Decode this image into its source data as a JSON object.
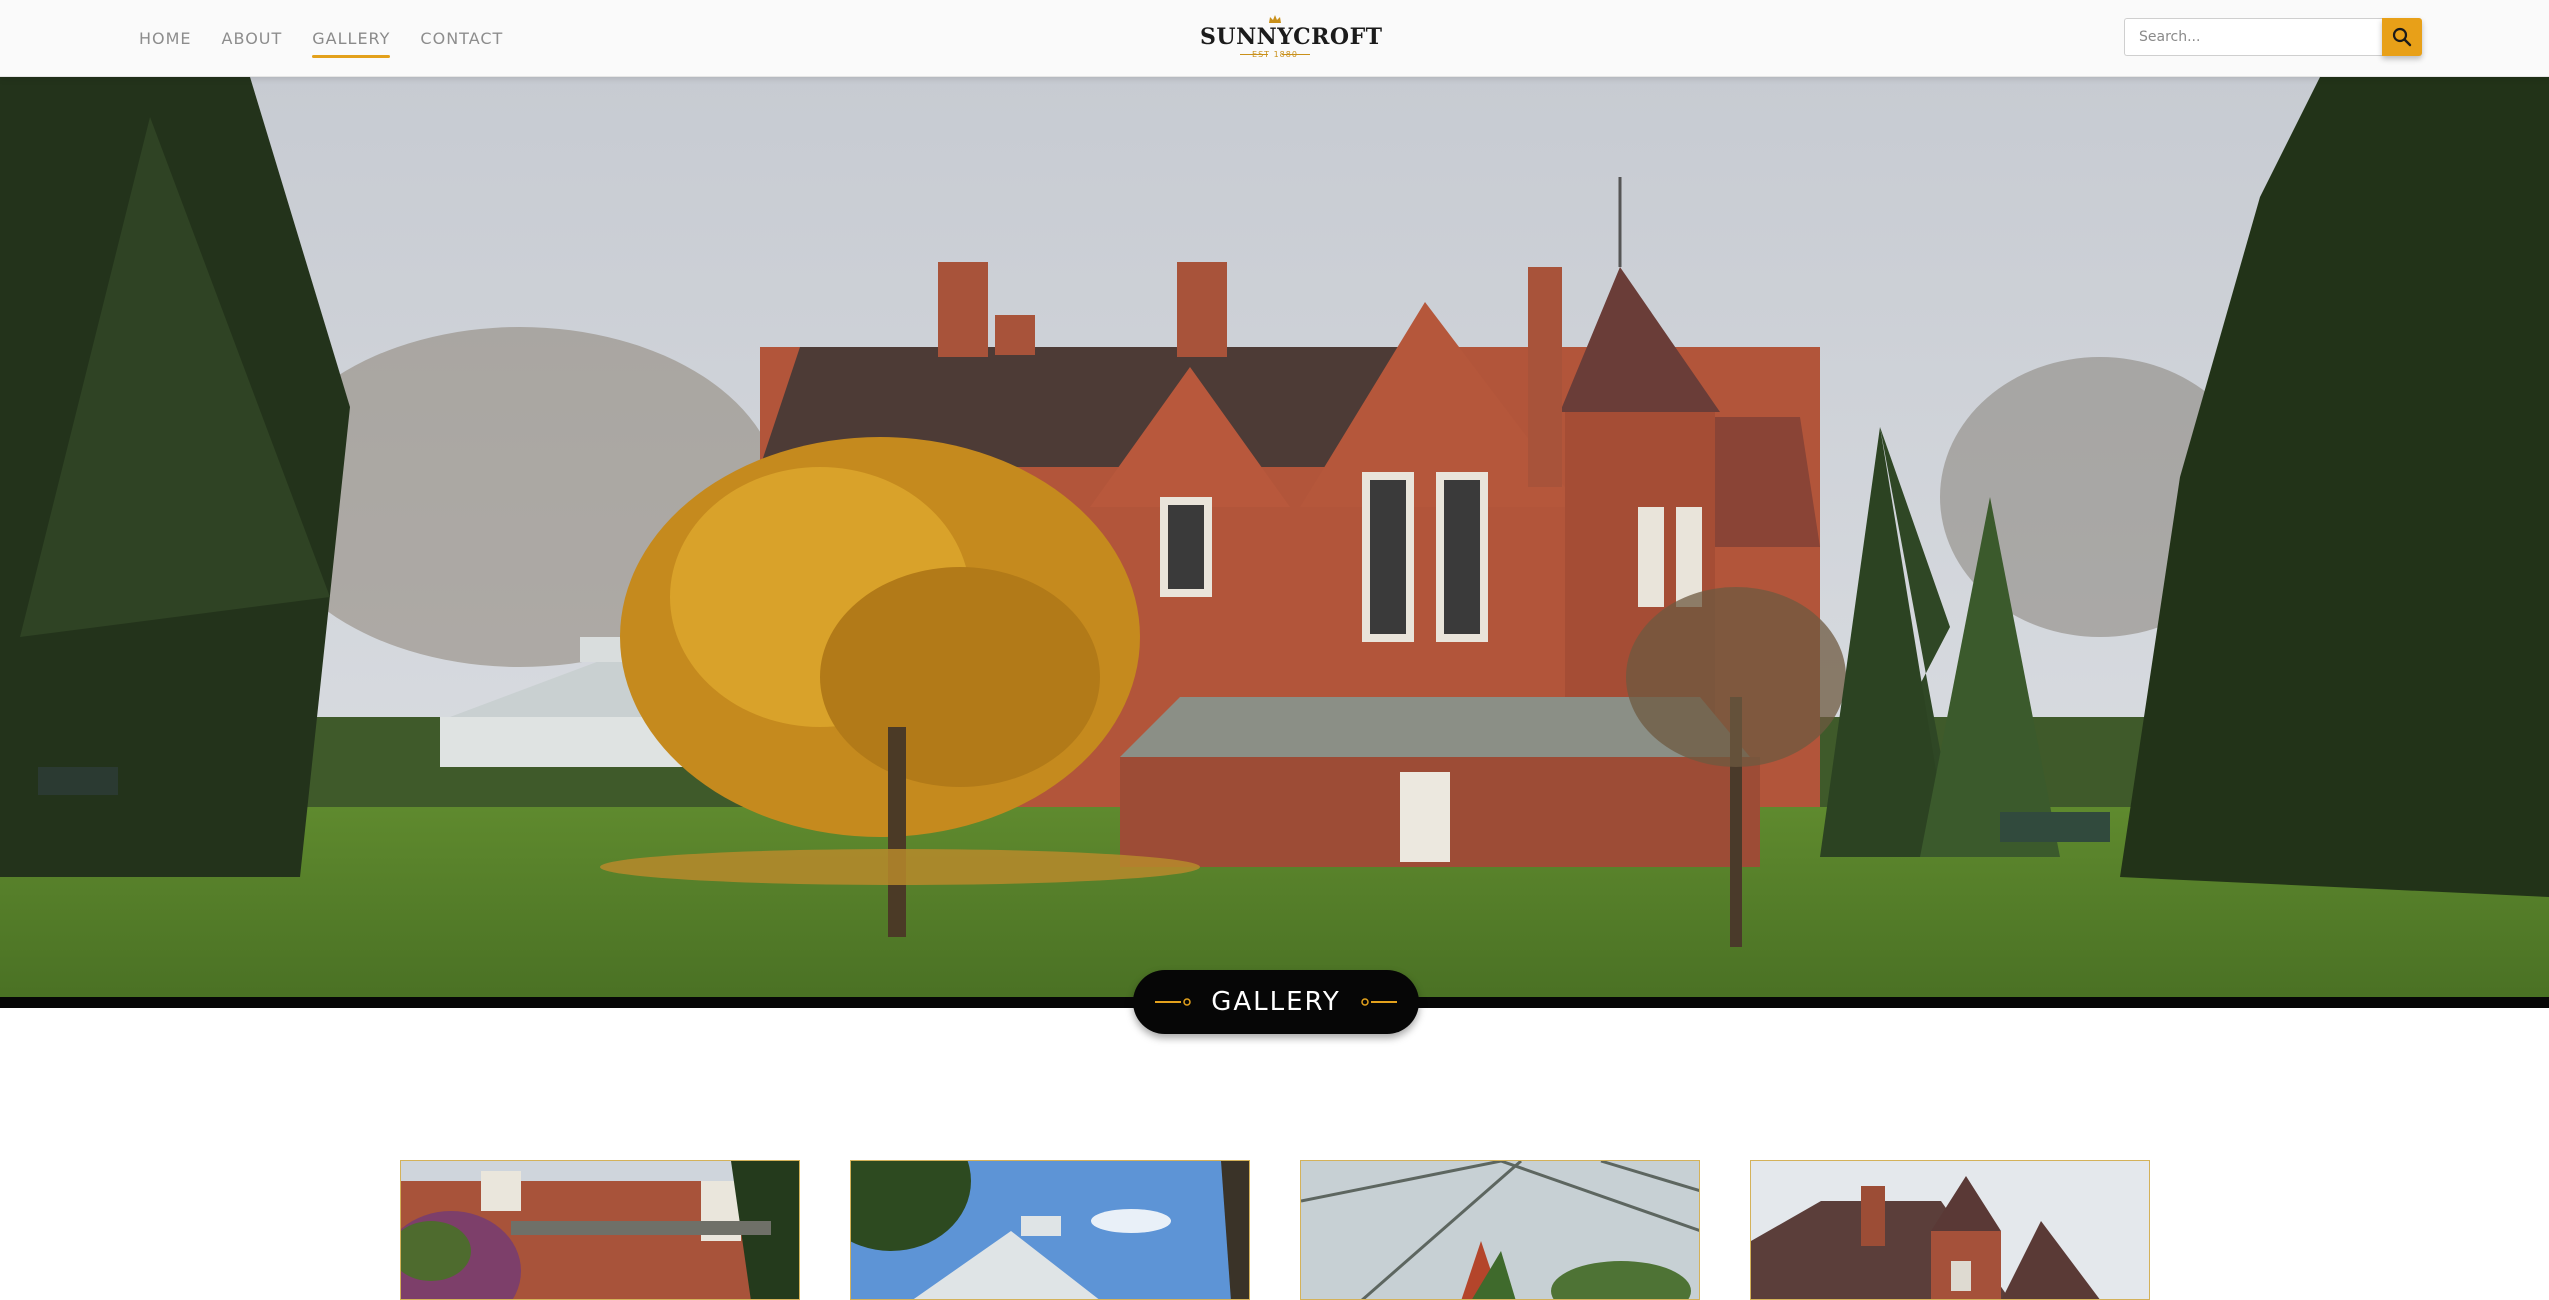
{
  "header": {
    "nav": [
      {
        "label": "HOME",
        "active": false
      },
      {
        "label": "ABOUT",
        "active": false
      },
      {
        "label": "GALLERY",
        "active": true
      },
      {
        "label": "CONTACT",
        "active": false
      }
    ],
    "logo": {
      "name": "SUNNYCROFT",
      "est": "EST 1880",
      "icon": "crown-icon"
    },
    "search": {
      "placeholder": "Search...",
      "value": "",
      "button_icon": "search-icon"
    }
  },
  "hero": {
    "image": "victorian-red-brick-house-with-conservatory-and-autumn-tree",
    "badge_label": "GALLERY"
  },
  "gallery": {
    "thumbnails": [
      {
        "image": "brick-house-with-flowering-shrubs"
      },
      {
        "image": "glass-conservatory-blue-sky"
      },
      {
        "image": "conservatory-interior-glass-roof"
      },
      {
        "image": "house-turret-and-chimneys"
      }
    ]
  },
  "colors": {
    "accent": "#e8a018",
    "badge_bg": "#060606",
    "header_bg": "#fafafa",
    "thumb_border": "#d4b25a"
  }
}
